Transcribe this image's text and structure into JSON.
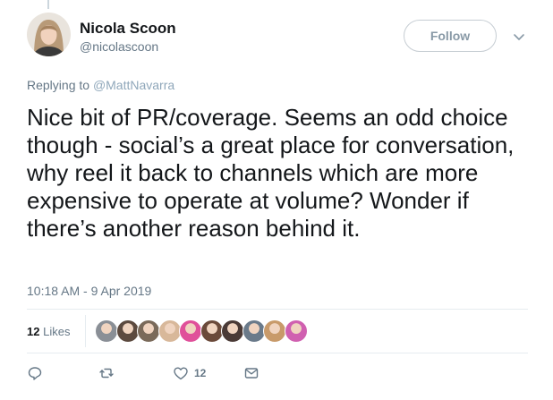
{
  "author": {
    "name": "Nicola Scoon",
    "handle": "@nicolascoon"
  },
  "follow_label": "Follow",
  "replying": {
    "prefix": "Replying to",
    "mention": "@MattNavarra"
  },
  "tweet": {
    "text": "Nice bit of PR/coverage. Seems an odd choice though - social’s a great place for conversation, why reel it back to channels which are more expensive to operate at volume? Wonder if there’s another reason behind it.",
    "timestamp": "10:18 AM - 9 Apr 2019"
  },
  "stats": {
    "likes_count": "12",
    "likes_label": "Likes"
  },
  "likers": [
    {
      "icon": "liker-avatar-1",
      "color": "#8a8f96"
    },
    {
      "icon": "liker-avatar-2",
      "color": "#5c4a3f"
    },
    {
      "icon": "liker-avatar-3",
      "color": "#7a6a5a"
    },
    {
      "icon": "liker-avatar-4",
      "color": "#d8b89a"
    },
    {
      "icon": "liker-avatar-5",
      "color": "#e0509a"
    },
    {
      "icon": "liker-avatar-6",
      "color": "#6b4a3a"
    },
    {
      "icon": "liker-avatar-7",
      "color": "#4a3a36"
    },
    {
      "icon": "liker-avatar-8",
      "color": "#6a7a8a"
    },
    {
      "icon": "liker-avatar-9",
      "color": "#c89a6a"
    },
    {
      "icon": "liker-avatar-10",
      "color": "#d060b0"
    }
  ],
  "actions": {
    "reply_icon": "reply-icon",
    "retweet_icon": "retweet-icon",
    "like_icon": "heart-icon",
    "like_count": "12",
    "dm_icon": "envelope-icon"
  },
  "colors": {
    "text": "#14171a",
    "muted": "#657786",
    "border": "#e6ecf0",
    "follow_border": "#c6cdd3"
  }
}
